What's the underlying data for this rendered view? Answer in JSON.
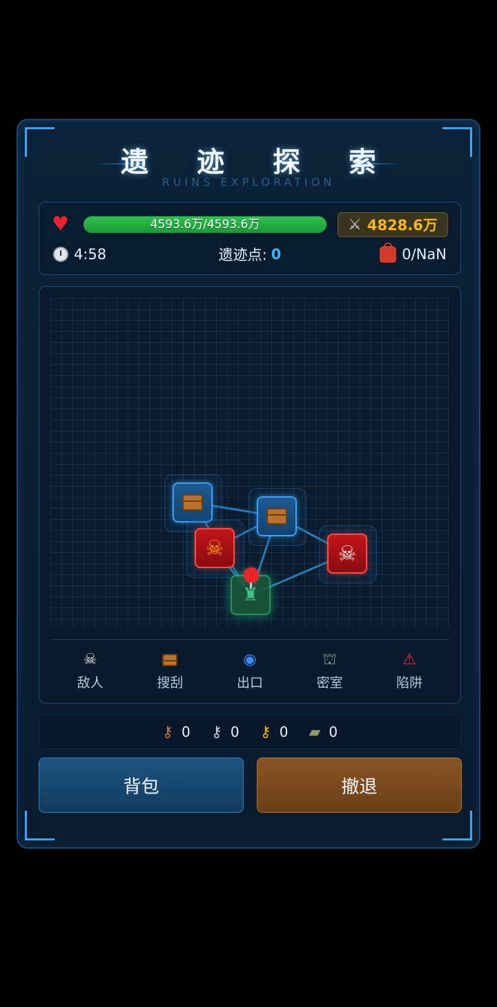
{
  "header": {
    "title": "遗 迹 探 索",
    "subtitle": "RUINS EXPLORATION"
  },
  "stats": {
    "hp_text": "4593.6万/4593.6万",
    "hp_fraction": 1.0,
    "power": "4828.6万",
    "timer": "4:58",
    "ruin_points_label": "遗迹点:",
    "ruin_points_value": "0",
    "bag": "0/NaN"
  },
  "map": {
    "nodes": [
      {
        "type": "chest",
        "icon": "chest-icon"
      },
      {
        "type": "chest",
        "icon": "chest-icon"
      },
      {
        "type": "enemy",
        "icon": "demon-skull-icon"
      },
      {
        "type": "enemy",
        "icon": "skull-icon"
      },
      {
        "type": "start",
        "icon": "player-pin-icon"
      }
    ]
  },
  "legend": [
    {
      "label": "敌人",
      "icon": "skull-icon"
    },
    {
      "label": "搜刮",
      "icon": "chest-icon"
    },
    {
      "label": "出口",
      "icon": "portal-icon"
    },
    {
      "label": "密室",
      "icon": "secret-room-icon"
    },
    {
      "label": "陷阱",
      "icon": "warning-icon"
    }
  ],
  "keys": [
    {
      "icon": "bronze-key-icon",
      "count": "0"
    },
    {
      "icon": "silver-key-icon",
      "count": "0"
    },
    {
      "icon": "gold-key-icon",
      "count": "0"
    },
    {
      "icon": "keycard-icon",
      "count": "0"
    }
  ],
  "buttons": {
    "bag": "背包",
    "retreat": "撤退"
  },
  "colors": {
    "accent": "#3aa6ff",
    "hp_green": "#22b043",
    "power_gold": "#f6b818",
    "retreat_brown": "#7a4a1e"
  }
}
